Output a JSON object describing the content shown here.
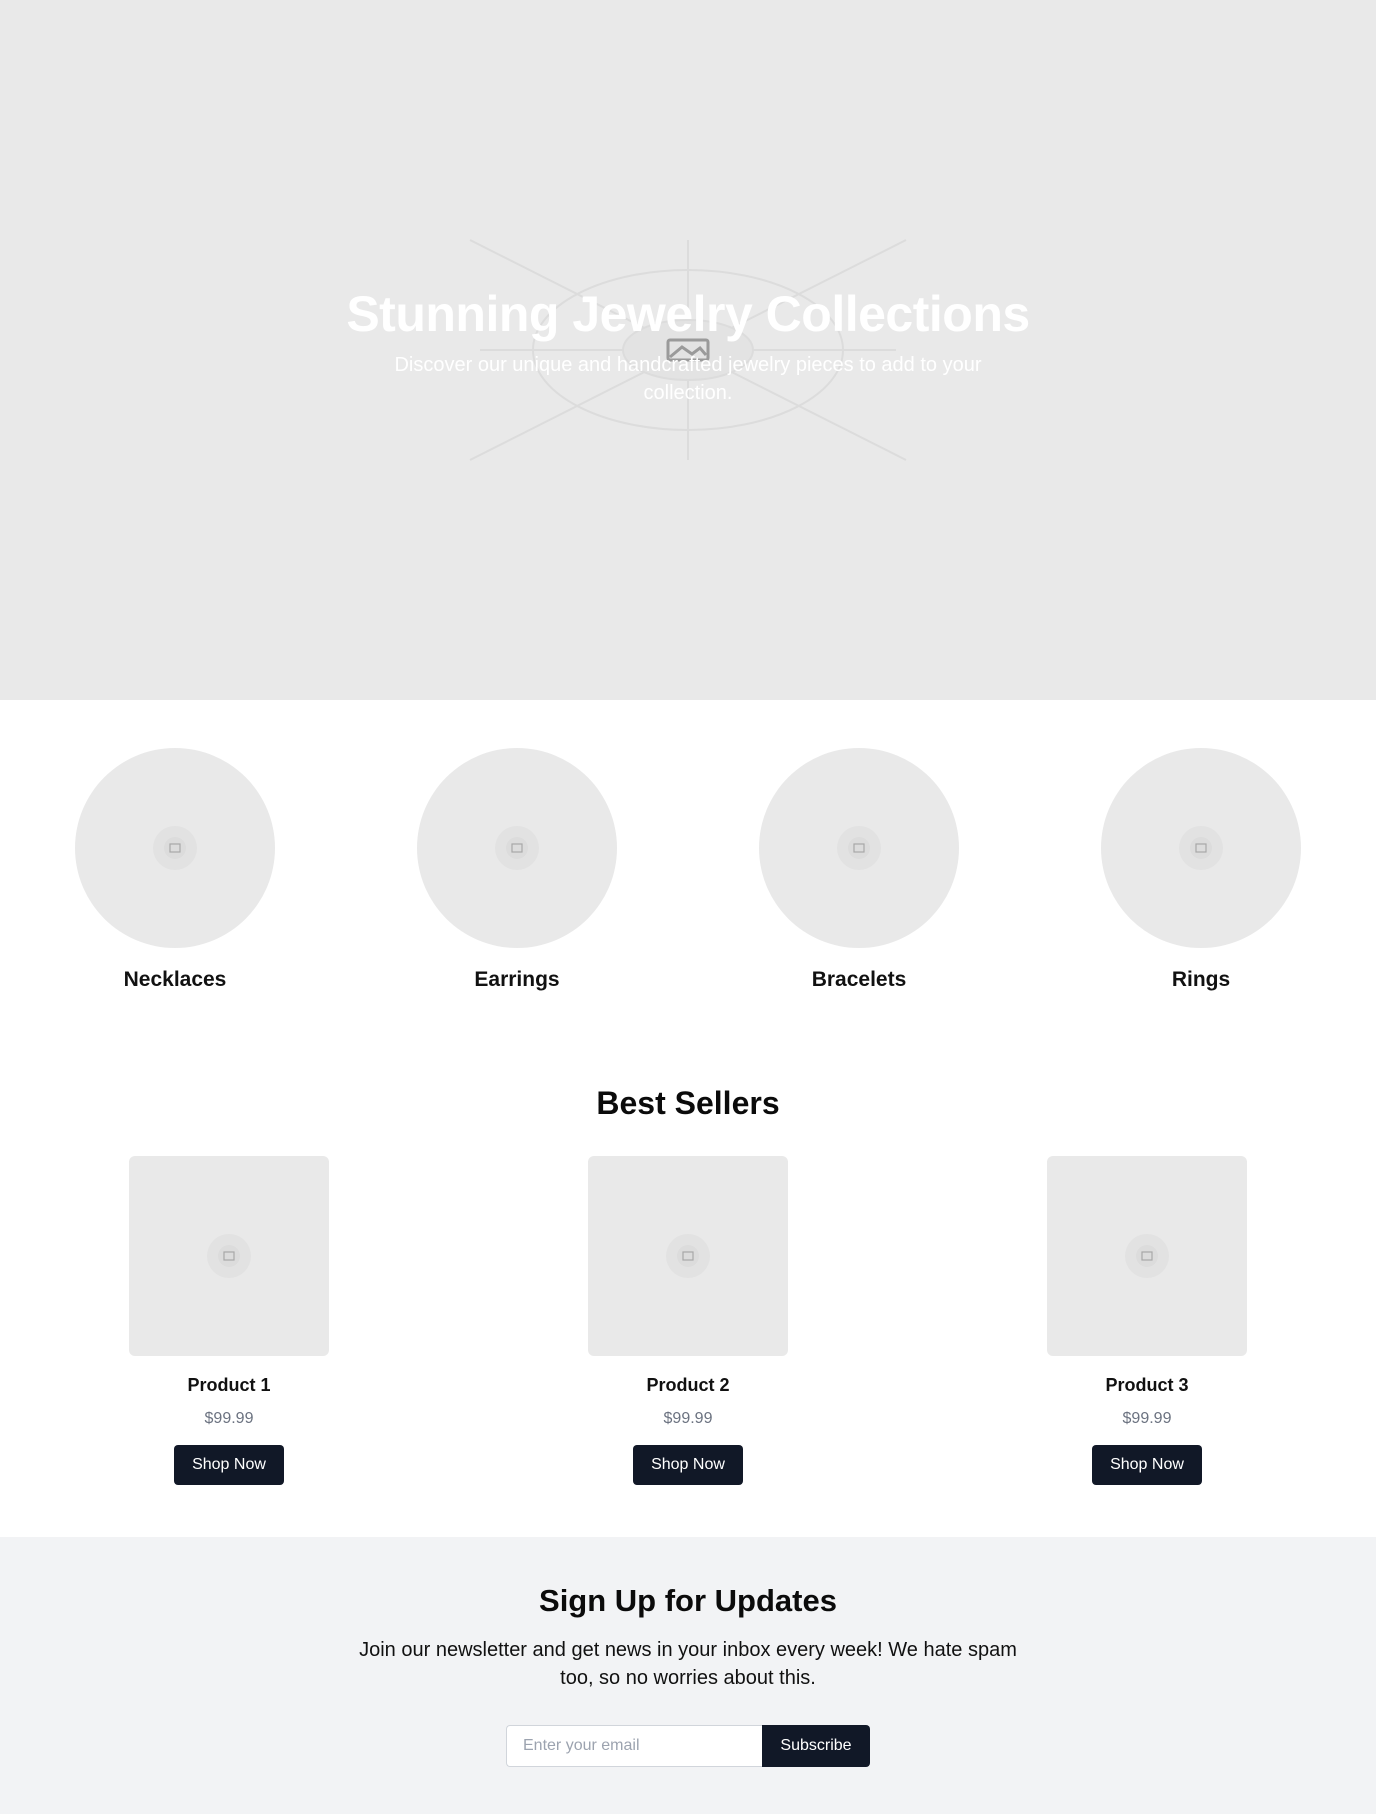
{
  "hero": {
    "title": "Stunning Jewelry Collections",
    "subtitle": "Discover our unique and handcrafted jewelry pieces to add to your collection.",
    "image_icon": "image-placeholder-icon"
  },
  "categories": [
    {
      "label": "Necklaces"
    },
    {
      "label": "Earrings"
    },
    {
      "label": "Bracelets"
    },
    {
      "label": "Rings"
    }
  ],
  "best_sellers": {
    "title": "Best Sellers",
    "products": [
      {
        "name": "Product 1",
        "price": "$99.99",
        "button": "Shop Now"
      },
      {
        "name": "Product 2",
        "price": "$99.99",
        "button": "Shop Now"
      },
      {
        "name": "Product 3",
        "price": "$99.99",
        "button": "Shop Now"
      }
    ]
  },
  "signup": {
    "title": "Sign Up for Updates",
    "text": "Join our newsletter and get news in your inbox every week! We hate spam too, so no worries about this.",
    "email_placeholder": "Enter your email",
    "button": "Subscribe"
  },
  "colors": {
    "placeholder_bg": "#e9e9e9",
    "button_bg": "#111827",
    "signup_bg": "#f2f3f5",
    "price_text": "#6b7280"
  }
}
